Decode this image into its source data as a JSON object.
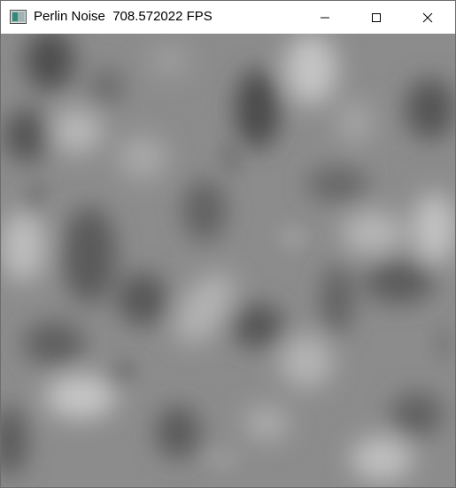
{
  "window": {
    "title": "Perlin Noise  708.572022 FPS",
    "app_icon": "window-app-icon",
    "controls": {
      "minimize": "minimize-icon",
      "maximize": "maximize-icon",
      "close": "close-icon"
    }
  },
  "canvas": {
    "content": "perlin-noise-grayscale",
    "colors": {
      "dark": "#4a4a4a",
      "mid": "#8a8a8a",
      "light": "#c8c8c8"
    }
  }
}
